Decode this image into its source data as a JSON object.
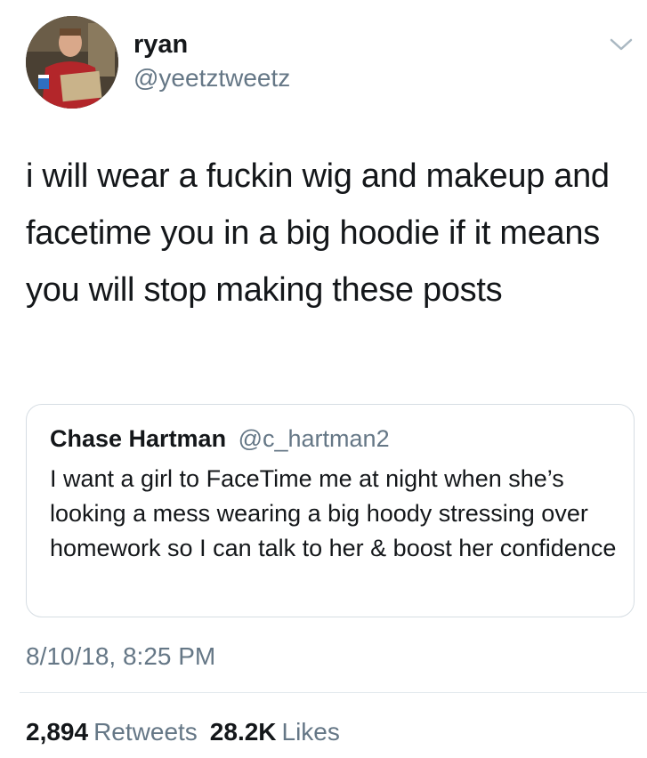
{
  "tweet": {
    "author": {
      "name": "ryan",
      "handle": "@yeetztweetz"
    },
    "text": "i will wear a fuckin wig and makeup and facetime you in a big hoodie if it means you will stop making these posts",
    "quoted": {
      "name": "Chase Hartman",
      "handle": "@c_hartman2",
      "text": "I want a girl to FaceTime me at night when she’s looking a mess wearing a big hoody stressing over homework so I can talk to her & boost her confidence"
    },
    "timestamp": "8/10/18, 8:25 PM",
    "stats": {
      "retweets_count": "2,894",
      "retweets_label": "Retweets",
      "likes_count": "28.2K",
      "likes_label": "Likes"
    }
  },
  "icons": {
    "menu": "chevron-down-icon"
  },
  "colors": {
    "text_primary": "#14171a",
    "text_secondary": "#657786",
    "border": "#d6dde3"
  }
}
